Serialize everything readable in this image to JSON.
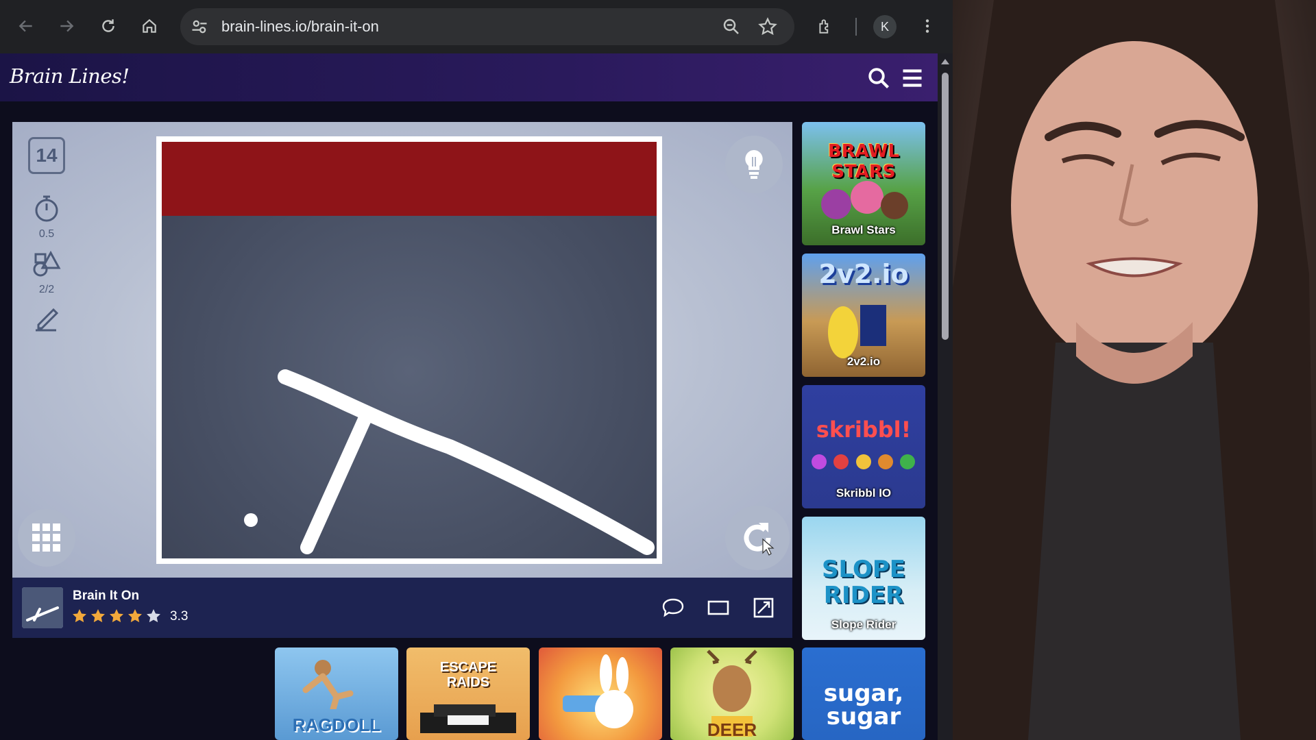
{
  "browser": {
    "url": "brain-lines.io/brain-it-on",
    "profile_initial": "K"
  },
  "site": {
    "logo": "Brain Lines!"
  },
  "game": {
    "level": "14",
    "timer_value": "0.5",
    "shapes_value": "2/2"
  },
  "info_bar": {
    "title": "Brain It On",
    "rating": "3.3",
    "stars_filled": 4
  },
  "side_games": [
    {
      "label": "Brawl Stars",
      "art": "BRAWL STARS"
    },
    {
      "label": "2v2.io",
      "art": "2v2.io"
    },
    {
      "label": "Skribbl IO",
      "art": "skribbl!"
    },
    {
      "label": "Slope Rider",
      "art": "SLOPE RIDER"
    }
  ],
  "bottom_games": [
    {
      "art": "RAGDOLL"
    },
    {
      "art": "ESCAPE RAIDS"
    },
    {
      "art": ""
    },
    {
      "art": "DEER"
    },
    {
      "art": "sugar, sugar"
    }
  ],
  "colors": {
    "header": "#2a1a5c",
    "info_bar": "#1d2351",
    "red_block": "#8e1418",
    "canvas": "#474f63"
  }
}
